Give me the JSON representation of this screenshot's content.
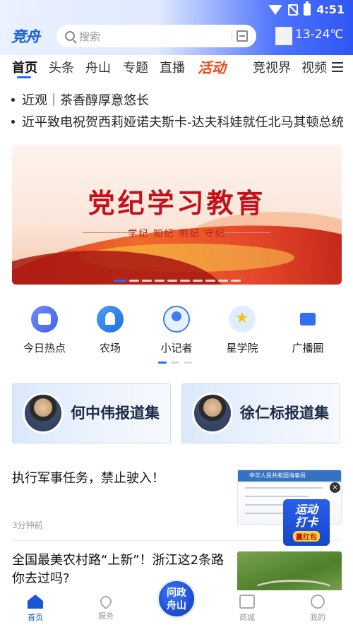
{
  "status_bar": {
    "time": "4:51"
  },
  "header": {
    "logo": "竞舟",
    "search_placeholder": "搜索",
    "weather": "13-24℃"
  },
  "tabs": [
    {
      "label": "首页",
      "active": true
    },
    {
      "label": "头条"
    },
    {
      "label": "舟山"
    },
    {
      "label": "专题"
    },
    {
      "label": "直播"
    },
    {
      "label": "活动"
    },
    {
      "label": "竞视界"
    },
    {
      "label": "视频"
    }
  ],
  "headlines": [
    "近观｜茶香醇厚意悠长",
    "近平致电祝贺西莉娅诺夫斯卡-达夫科娃就任北马其顿总统"
  ],
  "banner": {
    "title": "党纪学习教育",
    "subtitle": "学纪 知纪 明纪 守纪"
  },
  "quick_links": [
    {
      "label": "今日热点",
      "icon": "calendar-icon"
    },
    {
      "label": "农场",
      "icon": "plant-icon"
    },
    {
      "label": "小记者",
      "icon": "reporter-icon"
    },
    {
      "label": "星学院",
      "icon": "star-icon"
    },
    {
      "label": "广播圈",
      "icon": "radio-icon"
    }
  ],
  "reporter_cards": [
    {
      "name": "何中伟报道集"
    },
    {
      "name": "徐仁标报道集"
    }
  ],
  "news": [
    {
      "title": "执行军事任务，禁止驶入！",
      "time": "3分钟前",
      "thumb_header": "中华人民共和国海事局"
    },
    {
      "title": "全国最美农村路“上新”！浙江这2条路你去过吗?",
      "time": ""
    }
  ],
  "floating_badge": {
    "line1": "运动",
    "line2": "打卡",
    "line3": "赢红包",
    "close": "×"
  },
  "bottom_nav": {
    "home": "首页",
    "service": "服务",
    "center_line1": "问政",
    "center_line2": "舟山",
    "mall": "商城",
    "mine": "我的"
  },
  "colors": {
    "accent": "#2b6cf0",
    "activity": "#ee4a1a",
    "banner_red": "#c3121b"
  }
}
